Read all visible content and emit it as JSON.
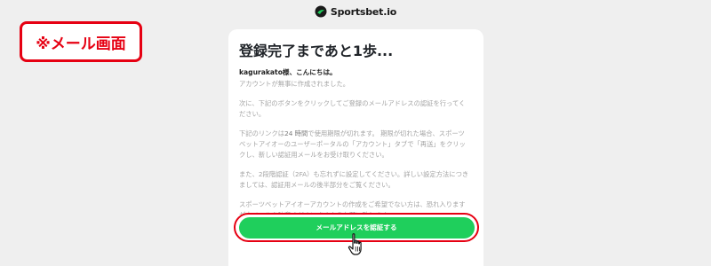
{
  "brand": {
    "name": "Sportsbet.io"
  },
  "note_badge": {
    "label": "※メール画面",
    "color": "#e60012"
  },
  "email": {
    "title": "登録完了まであと1歩...",
    "greeting": "kagurakato様、こんにちは。",
    "p1": "アカウントが無事に作成されました。",
    "p2": "次に、下記のボタンをクリックしてご登録のメールアドレスの認証を行ってください。",
    "p3_pre": "下記のリンクは",
    "p3_strong": "24 時間",
    "p3_post": "で使用期限が切れます。 期限が切れた場合、スポーツベットアイオーのユーザーポータルの「アカウント」タブで「再送」をクリックし、新しい認証用メールをお受け取りください。",
    "p4": "また、2段階認証（2FA）も忘れずに設定してください。詳しい設定方法につきましては、認証用メールの後半部分をご覧ください。",
    "p5": "スポーツベットアイオーアカウントの作成をご希望でない方は、恐れ入りますが本メールを破棄くださいますようお願い致します。",
    "cta_label": "メールアドレスを認証する"
  },
  "colors": {
    "accent_green": "#1fcf5c",
    "highlight_red": "#e60012"
  },
  "icons": {
    "brand": "sportsbet-logo-icon",
    "pointer": "hand-pointer-icon"
  }
}
